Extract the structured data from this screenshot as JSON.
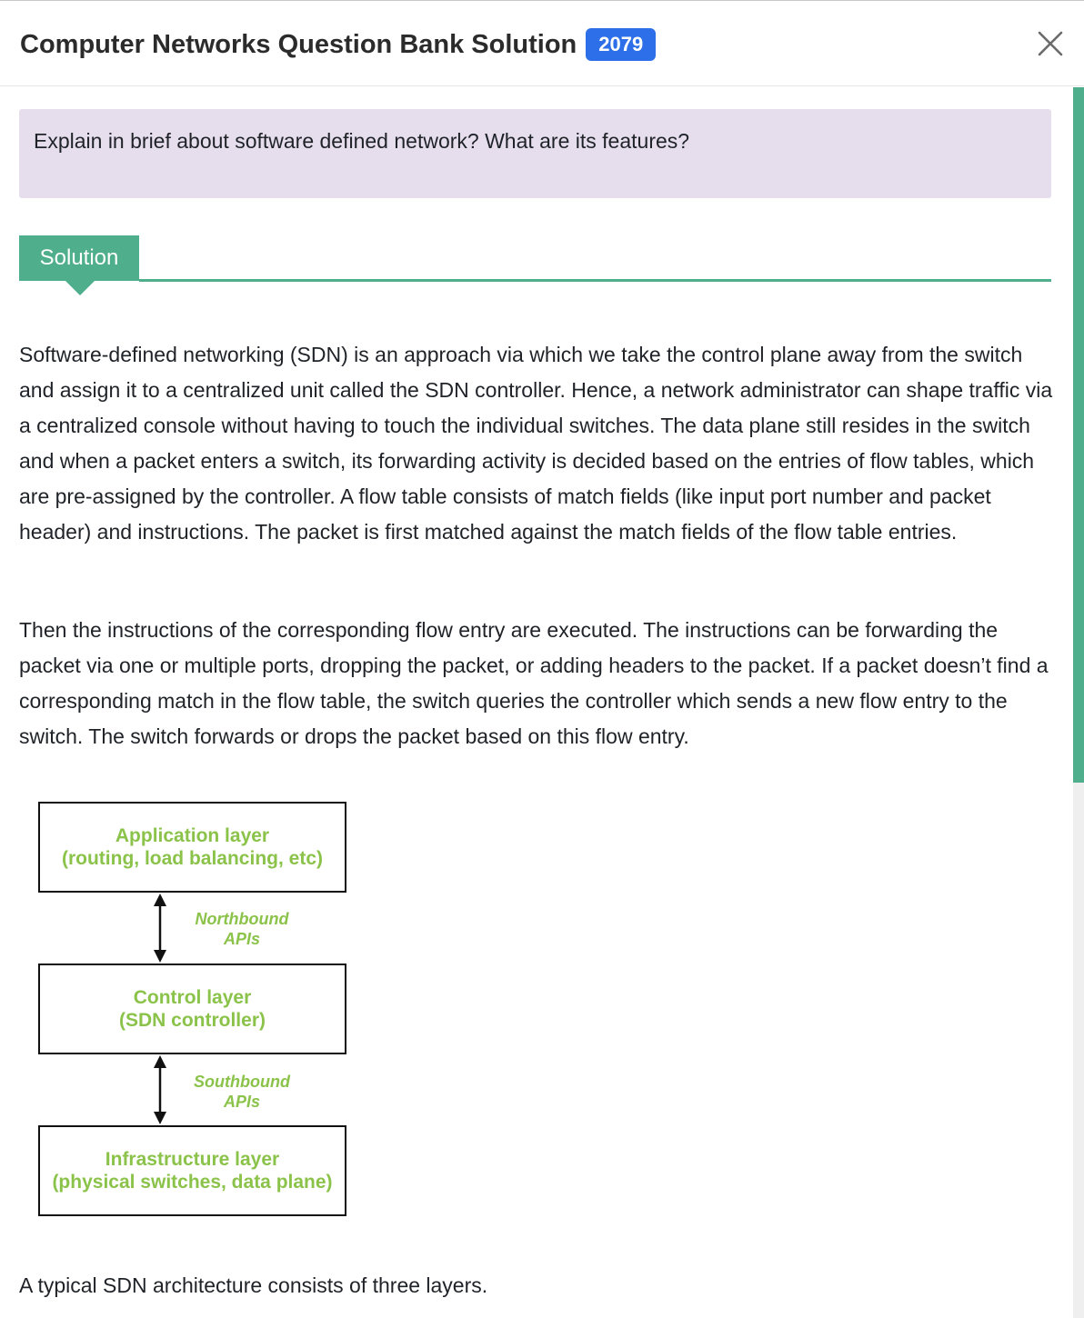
{
  "header": {
    "title": "Computer Networks Question Bank Solution",
    "year_badge": "2079"
  },
  "question": {
    "text": "Explain in brief about software defined network? What are its features?"
  },
  "solution_tab": {
    "label": "Solution"
  },
  "answer": {
    "paragraph_1": "Software-defined networking (SDN) is an approach via which we take the control plane away from the switch and assign it to a centralized unit called the SDN controller. Hence, a network administrator can shape traffic via a centralized console without having to touch the individual switches. The data plane still resides in the switch and when a packet enters a switch, its forwarding activity is decided based on the entries of flow tables, which are pre-assigned by the controller. A flow table consists of match fields (like input port number and packet header) and instructions. The packet is first matched against the match fields of the flow table entries.",
    "paragraph_2": "Then the instructions of the corresponding flow entry are executed. The instructions can be forwarding the packet via one or multiple ports, dropping the packet, or adding headers to the packet. If a packet doesn’t find a corresponding match in the flow table, the switch queries the controller which sends a new flow entry to the switch. The switch forwards or drops the packet based on this flow entry.",
    "caption": "A typical SDN architecture consists of three layers."
  },
  "diagram": {
    "application_layer": {
      "line1": "Application layer",
      "line2": "(routing, load balancing, etc)"
    },
    "northbound": {
      "line1": "Northbound",
      "line2": "APIs"
    },
    "control_layer": {
      "line1": "Control layer",
      "line2": "(SDN controller)"
    },
    "southbound": {
      "line1": "Southbound",
      "line2": "APIs"
    },
    "infrastructure_layer": {
      "line1": "Infrastructure layer",
      "line2": "(physical switches, data plane)"
    },
    "text_color": "#8bc34a"
  },
  "colors": {
    "accent_green": "#4fae8c",
    "badge_blue": "#2c6fe8",
    "question_bg": "#e6deed"
  },
  "icons": {
    "close": "close-icon"
  }
}
